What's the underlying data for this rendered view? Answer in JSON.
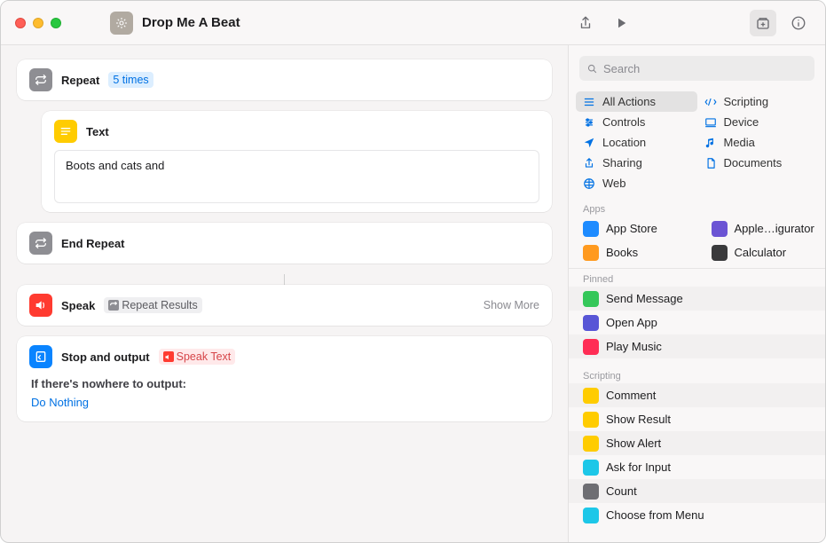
{
  "window": {
    "title": "Drop Me A Beat"
  },
  "editor": {
    "actions": {
      "repeat": {
        "title": "Repeat",
        "count_token": "5 times"
      },
      "text": {
        "title": "Text",
        "content": "Boots and cats and"
      },
      "end_repeat": {
        "title": "End Repeat"
      },
      "speak": {
        "title": "Speak",
        "var_token": "Repeat Results",
        "show_more": "Show More"
      },
      "stop": {
        "title": "Stop and output",
        "var_token": "Speak Text",
        "fallback_label": "If there's nowhere to output:",
        "fallback_value": "Do Nothing"
      }
    }
  },
  "sidebar": {
    "search_placeholder": "Search",
    "categories": {
      "left": [
        {
          "key": "all",
          "label": "All Actions",
          "selected": true
        },
        {
          "key": "controls",
          "label": "Controls"
        },
        {
          "key": "location",
          "label": "Location"
        },
        {
          "key": "sharing",
          "label": "Sharing"
        },
        {
          "key": "web",
          "label": "Web"
        }
      ],
      "right": [
        {
          "key": "scripting",
          "label": "Scripting"
        },
        {
          "key": "device",
          "label": "Device"
        },
        {
          "key": "media",
          "label": "Media"
        },
        {
          "key": "documents",
          "label": "Documents"
        }
      ]
    },
    "apps_label": "Apps",
    "apps_left": [
      {
        "label": "App Store",
        "color": "#1e8bff"
      },
      {
        "label": "Books",
        "color": "#ff9a1f"
      }
    ],
    "apps_right": [
      {
        "label": "Apple…igurator",
        "color": "#6b54d4"
      },
      {
        "label": "Calculator",
        "color": "#3a3a3c"
      }
    ],
    "pinned_label": "Pinned",
    "pinned": [
      {
        "label": "Send Message",
        "color": "#34c759"
      },
      {
        "label": "Open App",
        "color": "#5856d6"
      },
      {
        "label": "Play Music",
        "color": "#ff2d55"
      }
    ],
    "scripting_label": "Scripting",
    "scripting": [
      {
        "label": "Comment",
        "color": "#ffcc00"
      },
      {
        "label": "Show Result",
        "color": "#ffcc00"
      },
      {
        "label": "Show Alert",
        "color": "#ffcc00"
      },
      {
        "label": "Ask for Input",
        "color": "#1dc7e8"
      },
      {
        "label": "Count",
        "color": "#6e6e73"
      },
      {
        "label": "Choose from Menu",
        "color": "#1dc7e8"
      }
    ]
  }
}
